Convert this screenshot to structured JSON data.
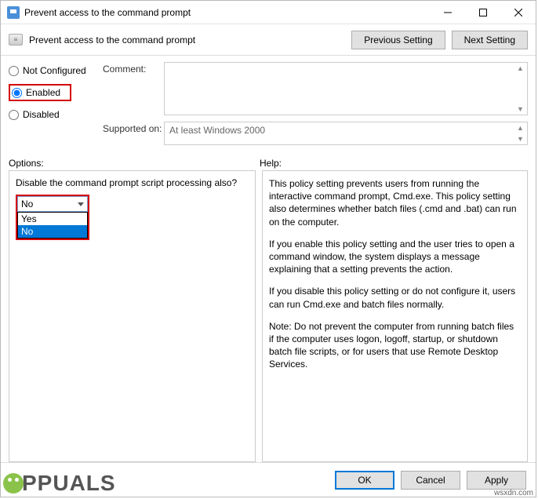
{
  "titlebar": {
    "title": "Prevent access to the command prompt"
  },
  "subheader": {
    "title": "Prevent access to the command prompt",
    "prev_btn": "Previous Setting",
    "next_btn": "Next Setting"
  },
  "radios": {
    "not_configured": "Not Configured",
    "enabled": "Enabled",
    "disabled": "Disabled"
  },
  "fields": {
    "comment_label": "Comment:",
    "supported_label": "Supported on:",
    "supported_value": "At least Windows 2000"
  },
  "sections": {
    "options": "Options:",
    "help": "Help:"
  },
  "options": {
    "question": "Disable the command prompt script processing also?",
    "selected": "No",
    "list": {
      "yes": "Yes",
      "no": "No"
    }
  },
  "help": {
    "p1": "This policy setting prevents users from running the interactive command prompt, Cmd.exe.  This policy setting also determines whether batch files (.cmd and .bat) can run on the computer.",
    "p2": "If you enable this policy setting and the user tries to open a command window, the system displays a message explaining that a setting prevents the action.",
    "p3": "If you disable this policy setting or do not configure it, users can run Cmd.exe and batch files normally.",
    "p4": "Note: Do not prevent the computer from running batch files if the computer uses logon, logoff, startup, or shutdown batch file scripts, or for users that use Remote Desktop Services."
  },
  "footer": {
    "ok": "OK",
    "cancel": "Cancel",
    "apply": "Apply"
  },
  "watermark": "PPUALS",
  "source": "wsxdn.com"
}
